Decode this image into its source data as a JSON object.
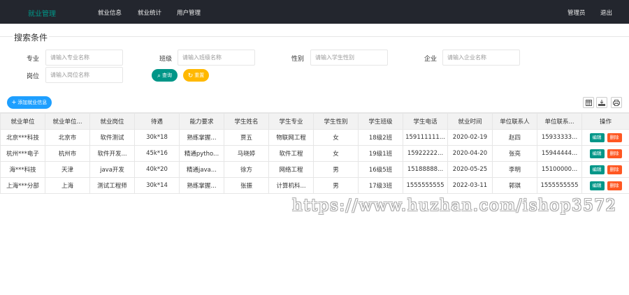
{
  "topnav": {
    "brand": "就业管理",
    "items": [
      "就业信息",
      "就业统计",
      "用户管理"
    ],
    "user": "管理员",
    "logout": "退出"
  },
  "search": {
    "legend": "搜索条件",
    "fields": [
      {
        "label": "专业",
        "placeholder": "请输入专业名称"
      },
      {
        "label": "班级",
        "placeholder": "请输入班级名称"
      },
      {
        "label": "性别",
        "placeholder": "请输入学生性别"
      },
      {
        "label": "企业",
        "placeholder": "请输入企业名称"
      },
      {
        "label": "岗位",
        "placeholder": "请输入岗位名称"
      }
    ],
    "query_label": "查询",
    "reset_label": "重置"
  },
  "toolbar": {
    "add_label": "添加就业信息",
    "icons": [
      "columns-icon",
      "export-icon",
      "print-icon"
    ]
  },
  "table": {
    "columns": [
      "就业单位",
      "就业单位...",
      "就业岗位",
      "待遇",
      "能力要求",
      "学生姓名",
      "学生专业",
      "学生性别",
      "学生班级",
      "学生电话",
      "就业时间",
      "单位联系人",
      "单位联系...",
      "操作"
    ],
    "rows": [
      [
        "北京***科技",
        "北京市",
        "软件测试",
        "30k*18",
        "熟练掌握...",
        "贾五",
        "物联网工程",
        "女",
        "18级2班",
        "159111111...",
        "2020-02-19",
        "赵四",
        "15933333..."
      ],
      [
        "杭州***电子",
        "杭州市",
        "软件开发...",
        "45k*16",
        "精通pytho...",
        "马晓婷",
        "软件工程",
        "女",
        "19级1班",
        "15922222...",
        "2020-04-20",
        "张亮",
        "15944444..."
      ],
      [
        "海***科技",
        "天津",
        "java开发",
        "40k*20",
        "精通java...",
        "徐方",
        "网络工程",
        "男",
        "16级5班",
        "15188888...",
        "2020-05-25",
        "李明",
        "15100000..."
      ],
      [
        "上海***分部",
        "上海",
        "测试工程师",
        "30k*14",
        "熟练掌握...",
        "张振",
        "计算机科...",
        "男",
        "17级3班",
        "1555555555",
        "2022-03-11",
        "郭琪",
        "1555555555"
      ]
    ],
    "edit_label": "编辑",
    "delete_label": "删除"
  },
  "watermark": "https://www.huzhan.com/ishop3572",
  "colors": {
    "nav_bg": "#23262e",
    "brand": "#009688",
    "primary": "#009688",
    "warm": "#ffb800",
    "normal": "#1e9fff",
    "danger": "#ff5722"
  }
}
